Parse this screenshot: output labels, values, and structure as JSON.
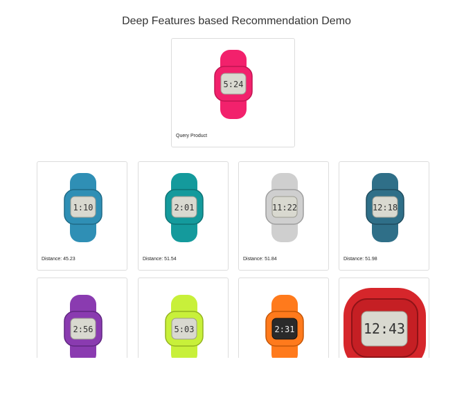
{
  "page": {
    "title": "Deep Features based Recommendation Demo"
  },
  "query": {
    "label": "Query Product",
    "band": "#f2216c",
    "display": "5:24"
  },
  "results": [
    {
      "label": "Distance: 45.23",
      "band": "#2f8fb5",
      "display": "1:10"
    },
    {
      "label": "Distance: 51.54",
      "band": "#149a9c",
      "display": "2:01"
    },
    {
      "label": "Distance: 51.84",
      "band": "#cfcfcf",
      "display": "11:22"
    },
    {
      "label": "Distance: 51.98",
      "band": "#2f6f88",
      "display": "12:18"
    },
    {
      "label": "",
      "band": "#8a3bb0",
      "display": "2:56"
    },
    {
      "label": "",
      "band": "#c8f03a",
      "display": "5:03"
    },
    {
      "label": "",
      "band": "#ff7a1c",
      "display": "2:31"
    },
    {
      "label": "",
      "band": "#d6262b",
      "display": "12:43"
    }
  ]
}
